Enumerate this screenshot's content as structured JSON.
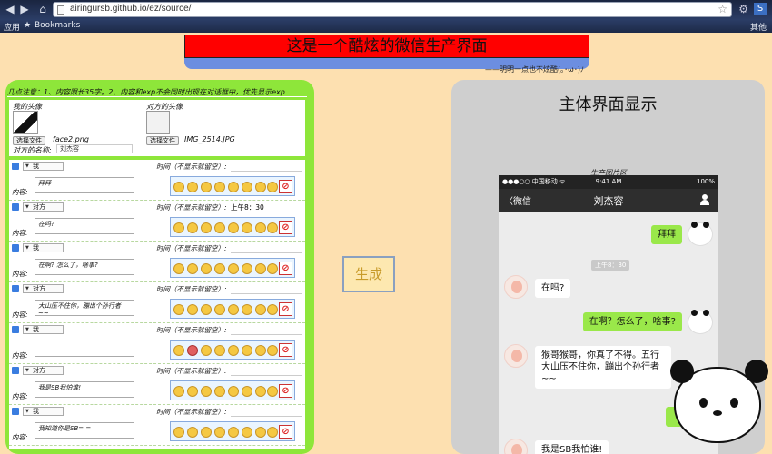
{
  "browser": {
    "url": "airingursb.github.io/ez/source/",
    "bookmarks": [
      "应用",
      "Bookmarks"
    ],
    "right_bookmark": "其他"
  },
  "header": {
    "title": "这是一个酷炫的微信生产界面",
    "subtitle": "——明明一点也不炫酷(｡･ω･)ﾉ"
  },
  "form": {
    "notice": "几点注意：1、内容限长35字。2、内容和exp不会同时出现在对话框中，优先显示exp",
    "my_avatar_label": "我的头像",
    "other_avatar_label": "对方的头像",
    "choose_file": "选择文件",
    "my_file": "face2.png",
    "other_file": "IMG_2514.JPG",
    "other_name_label": "对方的名称:",
    "other_name_value": "刘杰容",
    "time_label": "时间（不显示就留空）:",
    "content_label": "内容:",
    "messages": [
      {
        "sender": "我",
        "time": "",
        "content": "拜拜"
      },
      {
        "sender": "对方",
        "time": "上午8：30",
        "content": "在吗?"
      },
      {
        "sender": "我",
        "time": "",
        "content": "在啊? 怎么了，啥事?"
      },
      {
        "sender": "对方",
        "time": "",
        "content": "大山压不住你，蹦出个孙行者~~"
      },
      {
        "sender": "我",
        "time": "",
        "content": ""
      },
      {
        "sender": "对方",
        "time": "",
        "content": "我是SB我怕谁!"
      },
      {
        "sender": "我",
        "time": "",
        "content": "我知道你是SB= ="
      }
    ]
  },
  "generate_button": "生成",
  "preview": {
    "title": "主体界面显示",
    "image_label": "生产图片区",
    "status": {
      "carrier": "●●●○○ 中国移动 ᯤ",
      "time": "9:41 AM",
      "battery": "100%"
    },
    "nav_back": "微信",
    "nav_title": "刘杰容",
    "chat": {
      "b1": "拜拜",
      "ts": "上午8：30",
      "b2": "在吗?",
      "b3": "在啊？怎么了，啥事?",
      "b4": "猴哥猴哥，你真了不得。五行大山压不住你，蹦出个孙行者~~",
      "b5": "我是SB我怕谁!"
    }
  },
  "colors": {
    "banner_red": "#ff0000",
    "left_panel_green": "#8ee63a",
    "bubble_green": "#9ae84a",
    "background": "#fde0b0"
  }
}
